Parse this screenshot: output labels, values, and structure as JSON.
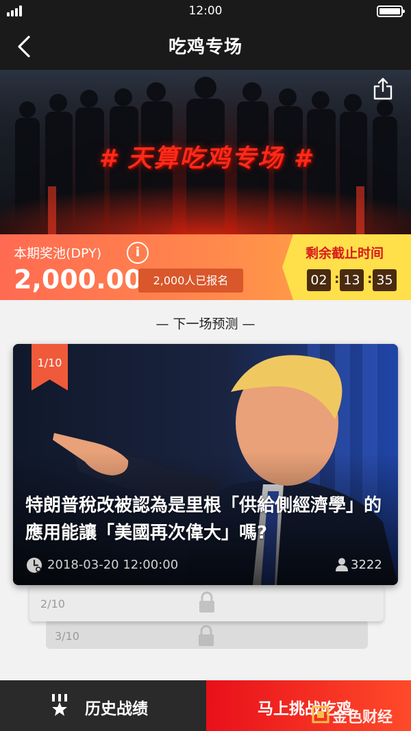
{
  "status_bar": {
    "time": "12:00"
  },
  "nav": {
    "title": "吃鸡专场"
  },
  "banner": {
    "title": "# 天算吃鸡专场 #"
  },
  "prize": {
    "label": "本期奖池(DPY)",
    "amount": "2,000.00",
    "enrolled": "2,000人已报名"
  },
  "countdown": {
    "label": "剩余截止时间",
    "hours": "02",
    "minutes": "13",
    "seconds": "35",
    "separator": ":"
  },
  "section": {
    "title": "— 下一场预测 —"
  },
  "cards": [
    {
      "index": "1/10",
      "headline": "特朗普稅改被認為是里根「供給側經濟學」的應用能讓「美國再次偉大」嗎?",
      "time": "2018-03-20 12:00:00",
      "participants": "3222",
      "locked": false
    },
    {
      "index": "2/10",
      "locked": true
    },
    {
      "index": "3/10",
      "locked": true
    }
  ],
  "bottom": {
    "history_label": "历史战绩",
    "challenge_label": "马上挑战吃鸡"
  },
  "watermark": {
    "text": "金色财经"
  },
  "colors": {
    "accent_red": "#e8101a",
    "prize_gradient_start": "#ff6a52",
    "prize_gradient_end": "#ffb23e",
    "countdown_bg": "#ffe04a",
    "dark_bar": "#2a2a2a"
  }
}
